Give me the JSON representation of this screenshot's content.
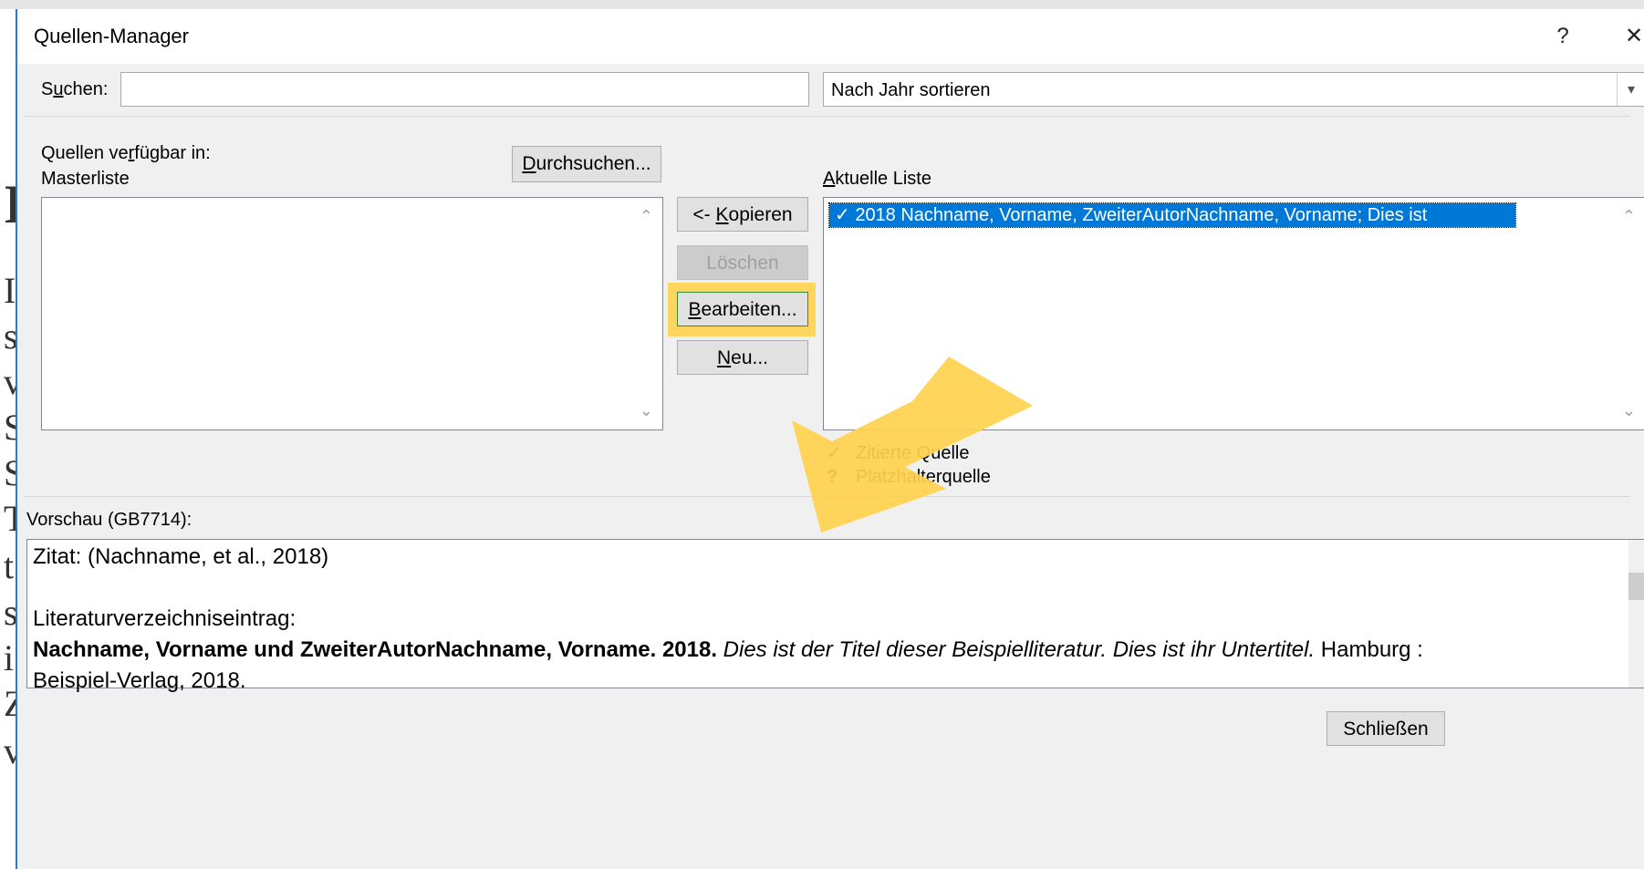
{
  "dialog": {
    "title": "Quellen-Manager",
    "help_label": "?",
    "close_label": "✕"
  },
  "search": {
    "label_pre": "S",
    "label_ul": "u",
    "label_post": "chen:",
    "value": "",
    "sort_value": "Nach Jahr sortieren"
  },
  "master": {
    "label_line1_pre": "Quellen ve",
    "label_line1_ul": "r",
    "label_line1_post": "fügbar in:",
    "label_line2": "Masterliste",
    "browse_ul": "D",
    "browse_post": "urchsuchen..."
  },
  "actions": {
    "copy_pre": "<- ",
    "copy_ul": "K",
    "copy_post": "opieren",
    "delete": "Löschen",
    "edit_ul": "B",
    "edit_post": "earbeiten...",
    "new_ul": "N",
    "new_post": "eu..."
  },
  "current": {
    "label_ul": "A",
    "label_post": "ktuelle Liste",
    "items": [
      "✓ 2018 Nachname, Vorname, ZweiterAutorNachname, Vorname; Dies ist"
    ]
  },
  "legend": [
    {
      "symbol": "✓",
      "text": "Zitierte Quelle"
    },
    {
      "symbol": "?",
      "text": "Platzhalterquelle"
    }
  ],
  "preview": {
    "label": "Vorschau (GB7714):",
    "citation": "Zitat:  (Nachname, et al., 2018)",
    "bib_label": "Literaturverzeichniseintrag:",
    "bib_bold": "Nachname, Vorname und ZweiterAutorNachname, Vorname. 2018.",
    "bib_italic": " Dies ist der Titel dieser Beispielliteratur. Dies ist ihr Untertitel.",
    "bib_rest": " Hamburg :",
    "bib_line2": "Beispiel-Verlag, 2018."
  },
  "footer": {
    "close": "Schließen"
  },
  "background_glyphs": [
    "I",
    "I",
    "s",
    "v",
    "S",
    "S",
    "T",
    "t",
    "s",
    "i",
    "Z",
    "v"
  ],
  "colors": {
    "accent": "#0078d7",
    "highlight": "#ffd24d",
    "dialog_bg": "#f0f0f0"
  }
}
